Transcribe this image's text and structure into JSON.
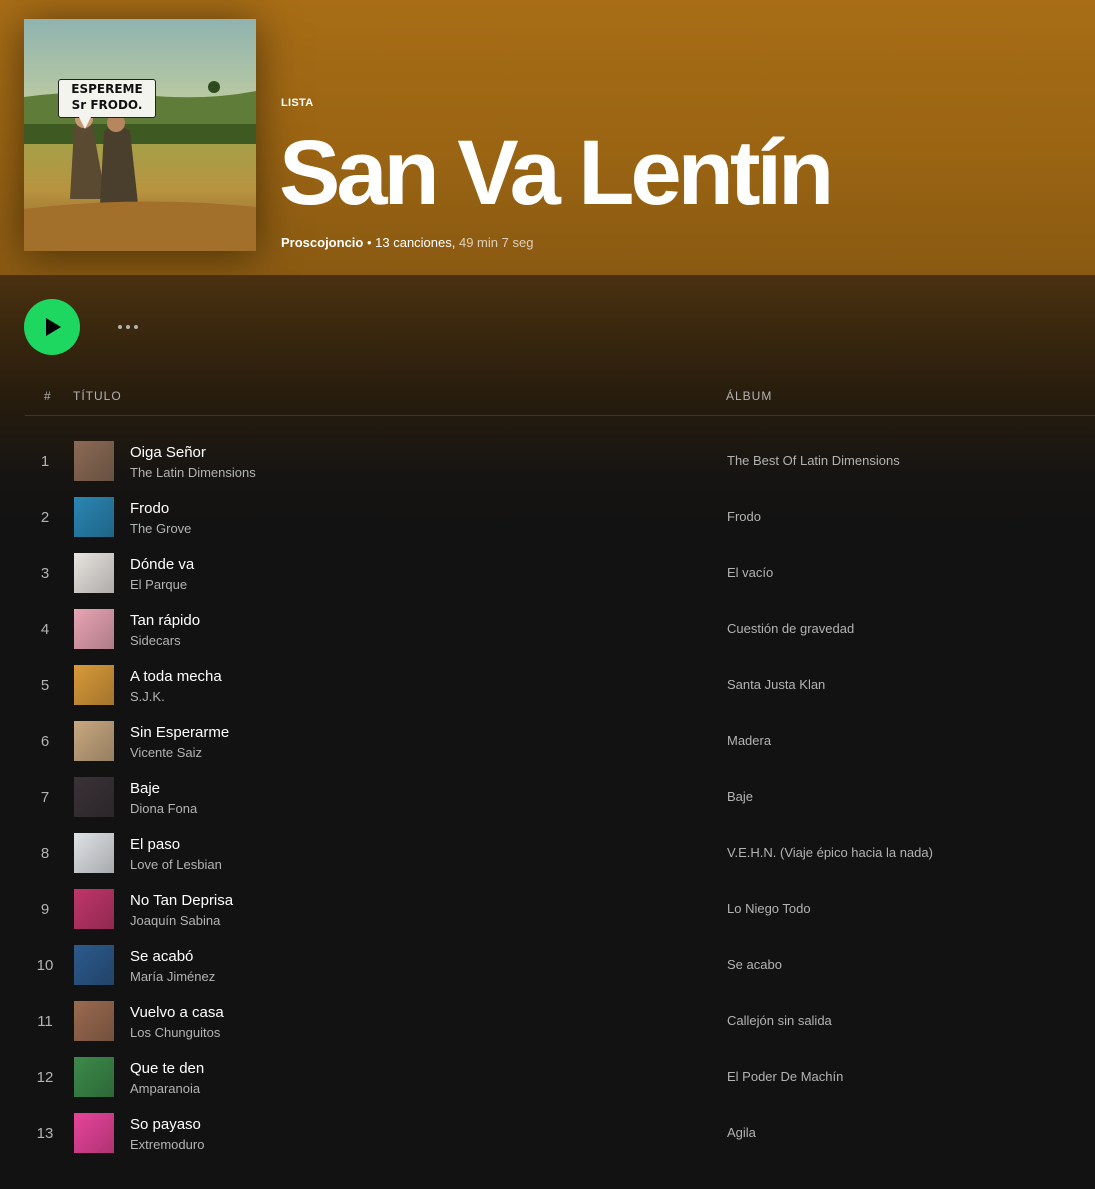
{
  "playlist": {
    "type_label": "LISTA",
    "title": "San Va Lentín",
    "owner": "Proscojoncio",
    "separator": " • ",
    "song_count": "13 canciones,",
    "duration": " 49 min 7 seg",
    "cover_text_line1": "ESPEREME",
    "cover_text_line2": "Sr FRODO."
  },
  "columns": {
    "number": "#",
    "title": "TÍTULO",
    "album": "ÁLBUM"
  },
  "colors": {
    "header": "#a86d16",
    "accent": "#1ed760",
    "background": "#121212",
    "muted_text": "#b3b3b3"
  },
  "icons": {
    "play": "play-icon",
    "more": "more-options-icon"
  },
  "tracks": [
    {
      "num": "1",
      "title": "Oiga Señor",
      "artist": "The Latin Dimensions",
      "album": "The Best Of Latin Dimensions",
      "thumb_color": "#8a6a55"
    },
    {
      "num": "2",
      "title": "Frodo",
      "artist": "The Grove",
      "album": "Frodo",
      "thumb_color": "#2a86b4"
    },
    {
      "num": "3",
      "title": "Dónde va",
      "artist": "El Parque",
      "album": "El vacío",
      "thumb_color": "#e8e4e0"
    },
    {
      "num": "4",
      "title": "Tan rápido",
      "artist": "Sidecars",
      "album": "Cuestión de gravedad",
      "thumb_color": "#e8a4b4"
    },
    {
      "num": "5",
      "title": "A toda mecha",
      "artist": "S.J.K.",
      "album": "Santa Justa Klan",
      "thumb_color": "#d89a3a"
    },
    {
      "num": "6",
      "title": "Sin Esperarme",
      "artist": "Vicente Saiz",
      "album": "Madera",
      "thumb_color": "#c8a880"
    },
    {
      "num": "7",
      "title": "Baje",
      "artist": "Diona Fona",
      "album": "Baje",
      "thumb_color": "#3a3236"
    },
    {
      "num": "8",
      "title": "El paso",
      "artist": "Love of Lesbian",
      "album": "V.E.H.N. (Viaje épico hacia la nada)",
      "thumb_color": "#dfe2e6"
    },
    {
      "num": "9",
      "title": "No Tan Deprisa",
      "artist": "Joaquín Sabina",
      "album": "Lo Niego Todo",
      "thumb_color": "#c0366a"
    },
    {
      "num": "10",
      "title": "Se acabó",
      "artist": "María Jiménez",
      "album": "Se acabo",
      "thumb_color": "#2c5a8c"
    },
    {
      "num": "11",
      "title": "Vuelvo a casa",
      "artist": "Los Chunguitos",
      "album": "Callejón sin salida",
      "thumb_color": "#9a6a50"
    },
    {
      "num": "12",
      "title": "Que te den",
      "artist": "Amparanoia",
      "album": "El Poder De Machín",
      "thumb_color": "#3c8a4a"
    },
    {
      "num": "13",
      "title": "So payaso",
      "artist": "Extremoduro",
      "album": "Agila",
      "thumb_color": "#e8449a"
    }
  ]
}
